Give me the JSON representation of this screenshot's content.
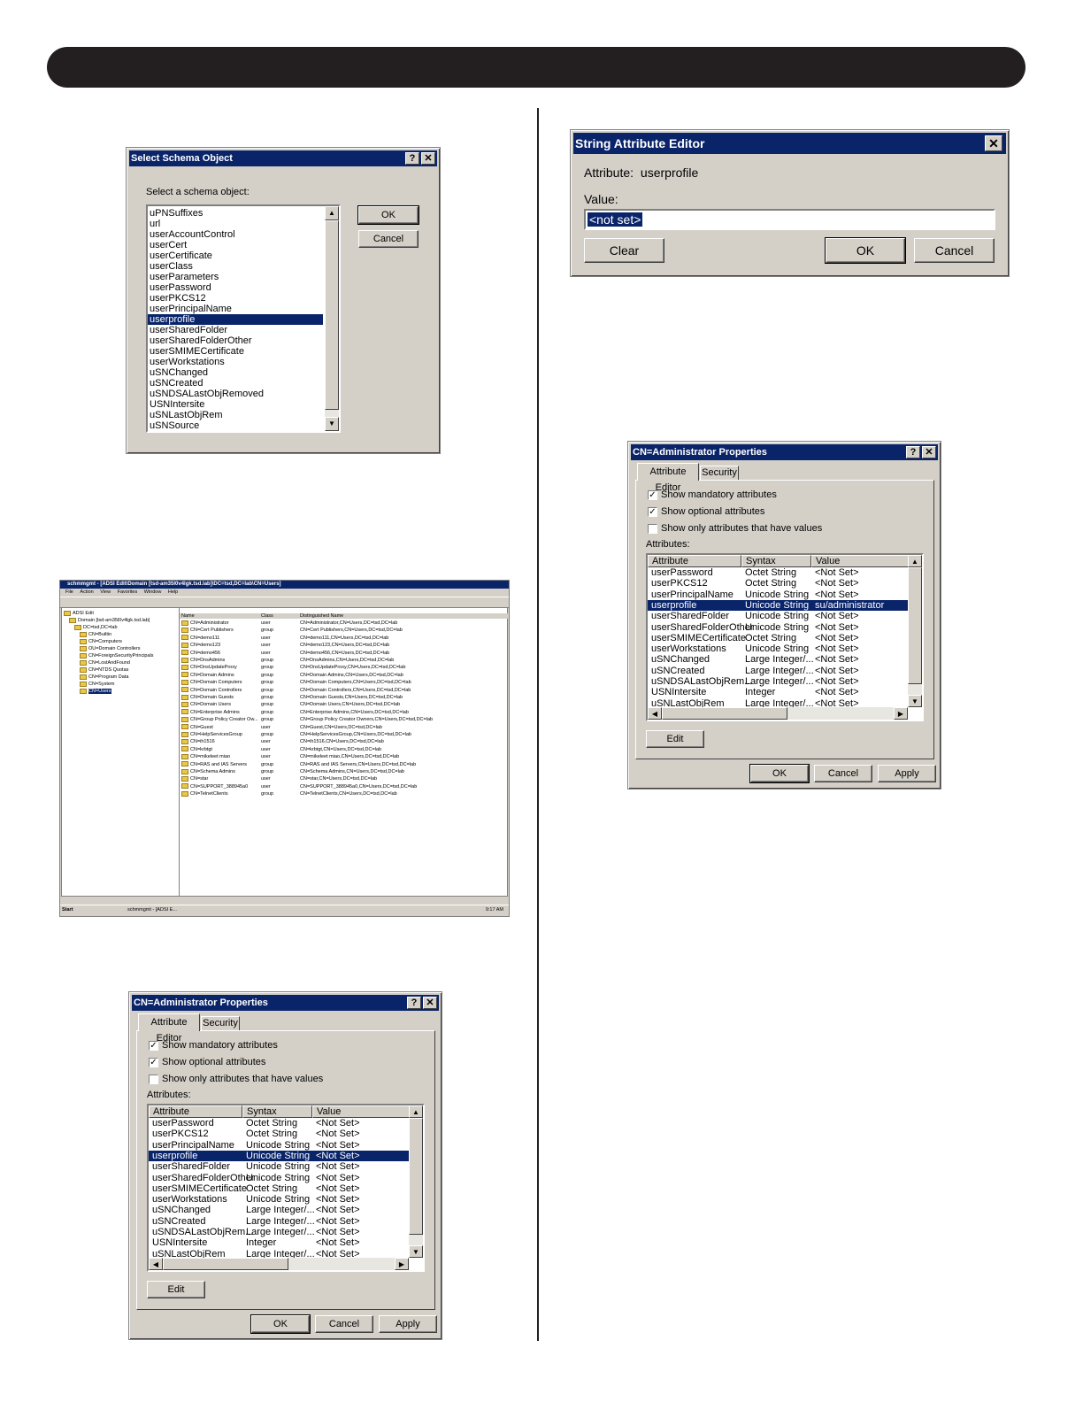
{
  "select_schema": {
    "title": "Select Schema Object",
    "help_icon": "?",
    "close_icon": "✕",
    "prompt": "Select a schema object:",
    "items": [
      "uPNSuffixes",
      "url",
      "userAccountControl",
      "userCert",
      "userCertificate",
      "userClass",
      "userParameters",
      "userPassword",
      "userPKCS12",
      "userPrincipalName",
      "userprofile",
      "userSharedFolder",
      "userSharedFolderOther",
      "userSMIMECertificate",
      "userWorkstations",
      "uSNChanged",
      "uSNCreated",
      "uSNDSALastObjRemoved",
      "USNIntersite",
      "uSNLastObjRem",
      "uSNSource"
    ],
    "selected_index": 10,
    "ok_label": "OK",
    "cancel_label": "Cancel"
  },
  "string_editor": {
    "title": "String Attribute Editor",
    "close_icon": "✕",
    "attribute_label": "Attribute:",
    "attribute_value": "userprofile",
    "value_label": "Value:",
    "value_text": "<not set>",
    "clear_label": "Clear",
    "ok_label": "OK",
    "cancel_label": "Cancel"
  },
  "adsi_window": {
    "title": "schmmgmt - [ADSI Edit\\Domain [tsd-am35l0v4lgk.tsd.lab]\\DC=tsd,DC=lab\\CN=Users]",
    "menu": [
      "File",
      "Action",
      "View",
      "Favorites",
      "Window",
      "Help"
    ],
    "tree": [
      "ADSI Edit",
      "Domain [tsd-am35l0v4lgk.tsd.lab]",
      "DC=tsd,DC=lab",
      "CN=Builtin",
      "CN=Computers",
      "OU=Domain Controllers",
      "CN=ForeignSecurityPrincipals",
      "CN=LostAndFound",
      "CN=NTDS Quotas",
      "CN=Program Data",
      "CN=System",
      "CN=Users"
    ],
    "columns": [
      "Name",
      "Class",
      "Distinguished Name"
    ],
    "rows": [
      [
        "CN=Administrator",
        "user",
        "CN=Administrator,CN=Users,DC=tsd,DC=lab"
      ],
      [
        "CN=Cert Publishers",
        "group",
        "CN=Cert Publishers,CN=Users,DC=tsd,DC=lab"
      ],
      [
        "CN=demo111",
        "user",
        "CN=demo111,CN=Users,DC=tsd,DC=lab"
      ],
      [
        "CN=demo123",
        "user",
        "CN=demo123,CN=Users,DC=tsd,DC=lab"
      ],
      [
        "CN=demo456",
        "user",
        "CN=demo456,CN=Users,DC=tsd,DC=lab"
      ],
      [
        "CN=DnsAdmins",
        "group",
        "CN=DnsAdmins,CN=Users,DC=tsd,DC=lab"
      ],
      [
        "CN=DnsUpdateProxy",
        "group",
        "CN=DnsUpdateProxy,CN=Users,DC=tsd,DC=lab"
      ],
      [
        "CN=Domain Admins",
        "group",
        "CN=Domain Admins,CN=Users,DC=tsd,DC=lab"
      ],
      [
        "CN=Domain Computers",
        "group",
        "CN=Domain Computers,CN=Users,DC=tsd,DC=lab"
      ],
      [
        "CN=Domain Controllers",
        "group",
        "CN=Domain Controllers,CN=Users,DC=tsd,DC=lab"
      ],
      [
        "CN=Domain Guests",
        "group",
        "CN=Domain Guests,CN=Users,DC=tsd,DC=lab"
      ],
      [
        "CN=Domain Users",
        "group",
        "CN=Domain Users,CN=Users,DC=tsd,DC=lab"
      ],
      [
        "CN=Enterprise Admins",
        "group",
        "CN=Enterprise Admins,CN=Users,DC=tsd,DC=lab"
      ],
      [
        "CN=Group Policy Creator Ow...",
        "group",
        "CN=Group Policy Creator Owners,CN=Users,DC=tsd,DC=lab"
      ],
      [
        "CN=Guest",
        "user",
        "CN=Guest,CN=Users,DC=tsd,DC=lab"
      ],
      [
        "CN=HelpServicesGroup",
        "group",
        "CN=HelpServicesGroup,CN=Users,DC=tsd,DC=lab"
      ],
      [
        "CN=ih1516",
        "user",
        "CN=ih1516,CN=Users,DC=tsd,DC=lab"
      ],
      [
        "CN=krbtgt",
        "user",
        "CN=krbtgt,CN=Users,DC=tsd,DC=lab"
      ],
      [
        "CN=mikeleet miao",
        "user",
        "CN=mikeleet miao,CN=Users,DC=tsd,DC=lab"
      ],
      [
        "CN=RAS and IAS Servers",
        "group",
        "CN=RAS and IAS Servers,CN=Users,DC=tsd,DC=lab"
      ],
      [
        "CN=Schema Admins",
        "group",
        "CN=Schema Admins,CN=Users,DC=tsd,DC=lab"
      ],
      [
        "CN=star",
        "user",
        "CN=star,CN=Users,DC=tsd,DC=lab"
      ],
      [
        "CN=SUPPORT_388945a0",
        "user",
        "CN=SUPPORT_388945a0,CN=Users,DC=tsd,DC=lab"
      ],
      [
        "CN=TelnetClients",
        "group",
        "CN=TelnetClients,CN=Users,DC=tsd,DC=lab"
      ]
    ],
    "start_label": "Start",
    "task_label": "schmmgmt - [ADSI E...",
    "clock": "9:17 AM"
  },
  "admin_props_top": {
    "title": "CN=Administrator Properties",
    "tab_attr": "Attribute Editor",
    "tab_security": "Security",
    "show_mandatory": "Show mandatory attributes",
    "show_optional": "Show optional attributes",
    "show_only_values": "Show only attributes that have values",
    "attributes_label": "Attributes:",
    "columns": [
      "Attribute",
      "Syntax",
      "Value"
    ],
    "rows": [
      [
        "userPassword",
        "Octet String",
        "<Not Set>"
      ],
      [
        "userPKCS12",
        "Octet String",
        "<Not Set>"
      ],
      [
        "userPrincipalName",
        "Unicode String",
        "<Not Set>"
      ],
      [
        "userprofile",
        "Unicode String",
        "su/administrator"
      ],
      [
        "userSharedFolder",
        "Unicode String",
        "<Not Set>"
      ],
      [
        "userSharedFolderOther",
        "Unicode String",
        "<Not Set>"
      ],
      [
        "userSMIMECertificate",
        "Octet String",
        "<Not Set>"
      ],
      [
        "userWorkstations",
        "Unicode String",
        "<Not Set>"
      ],
      [
        "uSNChanged",
        "Large Integer/...",
        "<Not Set>"
      ],
      [
        "uSNCreated",
        "Large Integer/...",
        "<Not Set>"
      ],
      [
        "uSNDSALastObjRem...",
        "Large Integer/...",
        "<Not Set>"
      ],
      [
        "USNIntersite",
        "Integer",
        "<Not Set>"
      ],
      [
        "uSNLastObjRem",
        "Large Integer/...",
        "<Not Set>"
      ]
    ],
    "selected_index": 3,
    "edit_label": "Edit",
    "ok_label": "OK",
    "cancel_label": "Cancel",
    "apply_label": "Apply"
  },
  "admin_props_bottom": {
    "title": "CN=Administrator Properties",
    "tab_attr": "Attribute Editor",
    "tab_security": "Security",
    "show_mandatory": "Show mandatory attributes",
    "show_optional": "Show optional attributes",
    "show_only_values": "Show only attributes that have values",
    "attributes_label": "Attributes:",
    "columns": [
      "Attribute",
      "Syntax",
      "Value"
    ],
    "rows": [
      [
        "userPassword",
        "Octet String",
        "<Not Set>"
      ],
      [
        "userPKCS12",
        "Octet String",
        "<Not Set>"
      ],
      [
        "userPrincipalName",
        "Unicode String",
        "<Not Set>"
      ],
      [
        "userprofile",
        "Unicode String",
        "<Not Set>"
      ],
      [
        "userSharedFolder",
        "Unicode String",
        "<Not Set>"
      ],
      [
        "userSharedFolderOther",
        "Unicode String",
        "<Not Set>"
      ],
      [
        "userSMIMECertificate",
        "Octet String",
        "<Not Set>"
      ],
      [
        "userWorkstations",
        "Unicode String",
        "<Not Set>"
      ],
      [
        "uSNChanged",
        "Large Integer/...",
        "<Not Set>"
      ],
      [
        "uSNCreated",
        "Large Integer/...",
        "<Not Set>"
      ],
      [
        "uSNDSALastObjRem...",
        "Large Integer/...",
        "<Not Set>"
      ],
      [
        "USNIntersite",
        "Integer",
        "<Not Set>"
      ],
      [
        "uSNLastObjRem",
        "Large Integer/...",
        "<Not Set>"
      ]
    ],
    "selected_index": 3,
    "edit_label": "Edit",
    "ok_label": "OK",
    "cancel_label": "Cancel",
    "apply_label": "Apply"
  }
}
